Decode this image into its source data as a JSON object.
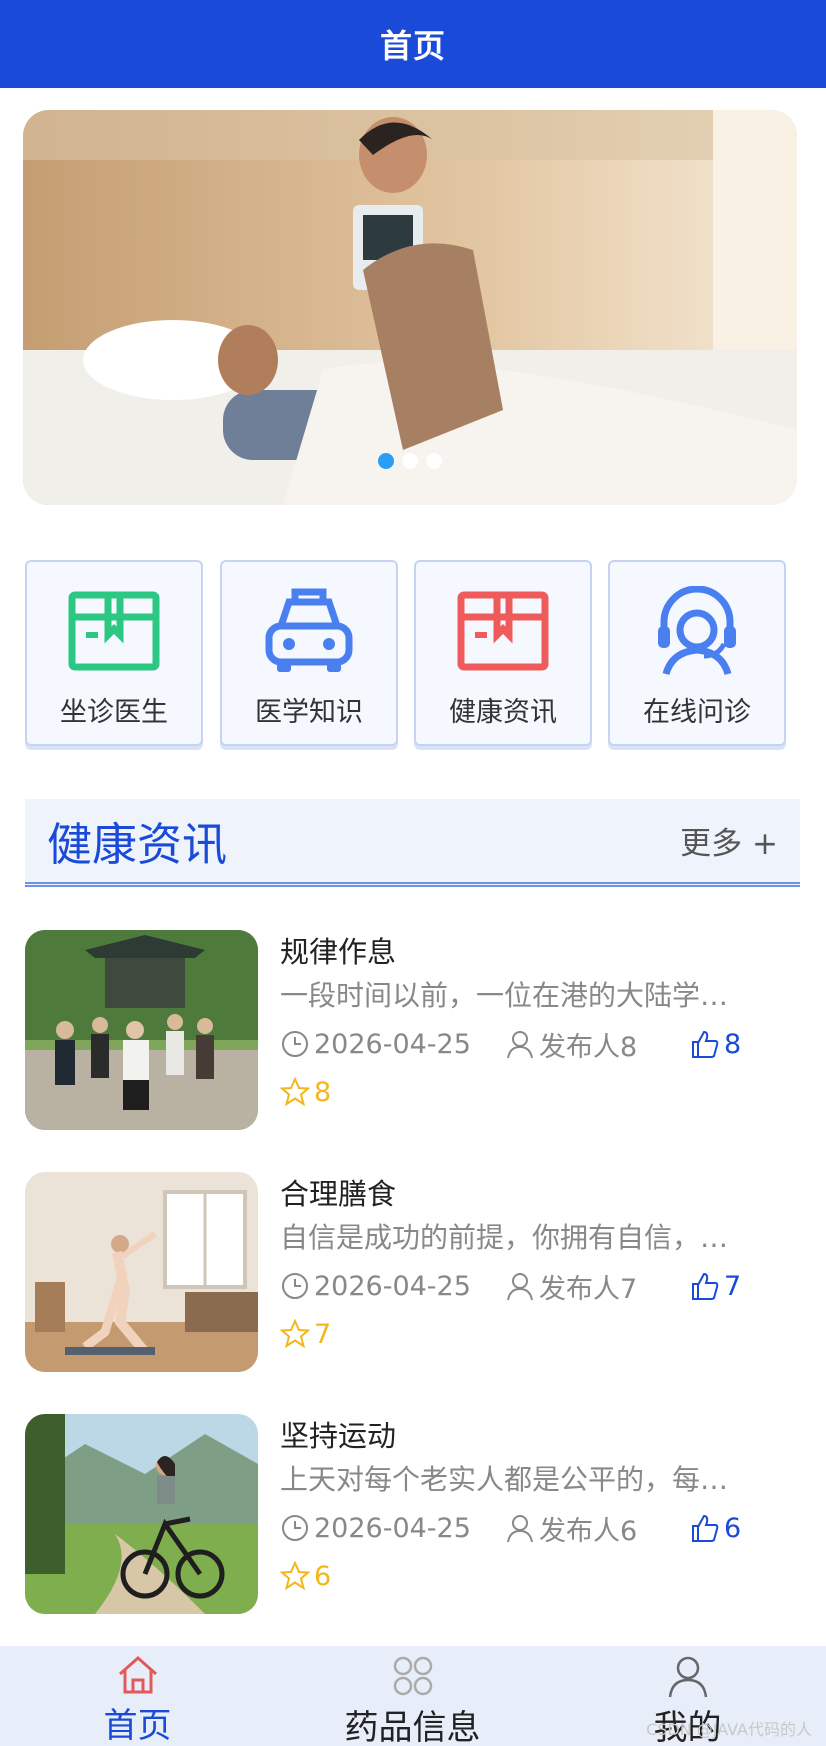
{
  "header": {
    "title": "首页"
  },
  "banner": {
    "dots": 3,
    "active_dot": 0
  },
  "quick_menu": [
    {
      "label": "坐诊医生",
      "icon": "box-icon",
      "color": "#2bc783"
    },
    {
      "label": "医学知识",
      "icon": "car-icon",
      "color": "#4a7ff0"
    },
    {
      "label": "健康资讯",
      "icon": "box-icon",
      "color": "#ef5b5b"
    },
    {
      "label": "在线问诊",
      "icon": "headset-icon",
      "color": "#4a7ff0"
    }
  ],
  "section": {
    "title": "健康资讯",
    "more": "更多 +"
  },
  "news": [
    {
      "title": "规律作息",
      "excerpt": "一段时间以前，一位在港的大陆学…",
      "date": "2026-04-25",
      "author": "发布人8",
      "likes": "8",
      "favs": "8"
    },
    {
      "title": "合理膳食",
      "excerpt": "自信是成功的前提，你拥有自信，…",
      "date": "2026-04-25",
      "author": "发布人7",
      "likes": "7",
      "favs": "7"
    },
    {
      "title": "坚持运动",
      "excerpt": "上天对每个老实人都是公平的，每…",
      "date": "2026-04-25",
      "author": "发布人6",
      "likes": "6",
      "favs": "6"
    }
  ],
  "tabbar": [
    {
      "label": "首页",
      "icon": "home-icon",
      "active": true
    },
    {
      "label": "药品信息",
      "icon": "grid-icon",
      "active": false
    },
    {
      "label": "我的",
      "icon": "user-icon",
      "active": false
    }
  ],
  "colors": {
    "primary": "#1a4ad8",
    "star": "#f3b71a",
    "like": "#1a4ad8"
  },
  "watermark": "CSDN @JAVA代码的人"
}
